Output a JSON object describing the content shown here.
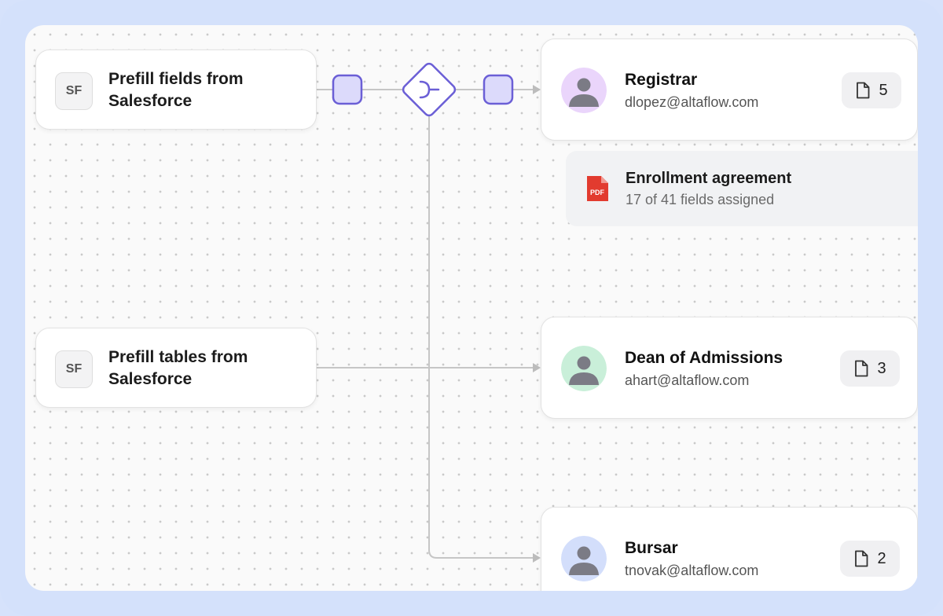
{
  "sources": [
    {
      "badge": "SF",
      "label": "Prefill fields from Salesforce"
    },
    {
      "badge": "SF",
      "label": "Prefill tables from Salesforce"
    }
  ],
  "roles": [
    {
      "name": "Registrar",
      "email": "dlopez@altaflow.com",
      "doc_count": "5",
      "avatar_color": "#ead5fb"
    },
    {
      "name": "Dean of Admissions",
      "email": "ahart@altaflow.com",
      "doc_count": "3",
      "avatar_color": "#c9efd9"
    },
    {
      "name": "Bursar",
      "email": "tnovak@altaflow.com",
      "doc_count": "2",
      "avatar_color": "#d3defb"
    }
  ],
  "document": {
    "icon": "pdf-icon",
    "icon_text": "PDF",
    "title": "Enrollment agreement",
    "subtitle": "17 of 41 fields assigned"
  },
  "colors": {
    "accent": "#6b5fd6",
    "node_fill": "#dcdafb",
    "wire": "#c6c6c6",
    "pdf_red": "#e23b2f"
  },
  "icons": {
    "merge": "merge-icon",
    "document": "document-icon",
    "avatar": "person-icon"
  }
}
